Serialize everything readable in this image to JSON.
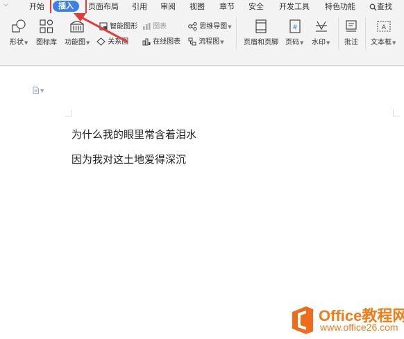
{
  "tabs": {
    "menu": "≡",
    "home": "开始",
    "insert": "插入",
    "page_layout": "页面布局",
    "references": "引用",
    "review": "审阅",
    "view": "视图",
    "chapter": "章节",
    "security": "安全",
    "developer": "开发工具",
    "features": "特色功能",
    "search": "查找"
  },
  "ribbon": {
    "shapes": "形状",
    "icon_library": "图标库",
    "function_chart": "功能图",
    "smart_art": "智能图形",
    "chart": "图表",
    "mind_map": "思维导图",
    "relation_chart": "关系图",
    "online_chart": "在线图表",
    "flowchart": "流程图",
    "header_footer": "页眉和页脚",
    "page_number": "页码",
    "watermark": "水印",
    "comment": "批注",
    "textbox": "文本框"
  },
  "document": {
    "line1": "为什么我的眼里常含着泪水",
    "line2": "因为我对这土地爱得深沉"
  },
  "watermark_logo": {
    "title": "Office教程网",
    "url": "www.office26.com"
  },
  "colors": {
    "active_tab": "#3f7fe8",
    "highlight": "#e53935",
    "logo": "#ef7d1a"
  }
}
